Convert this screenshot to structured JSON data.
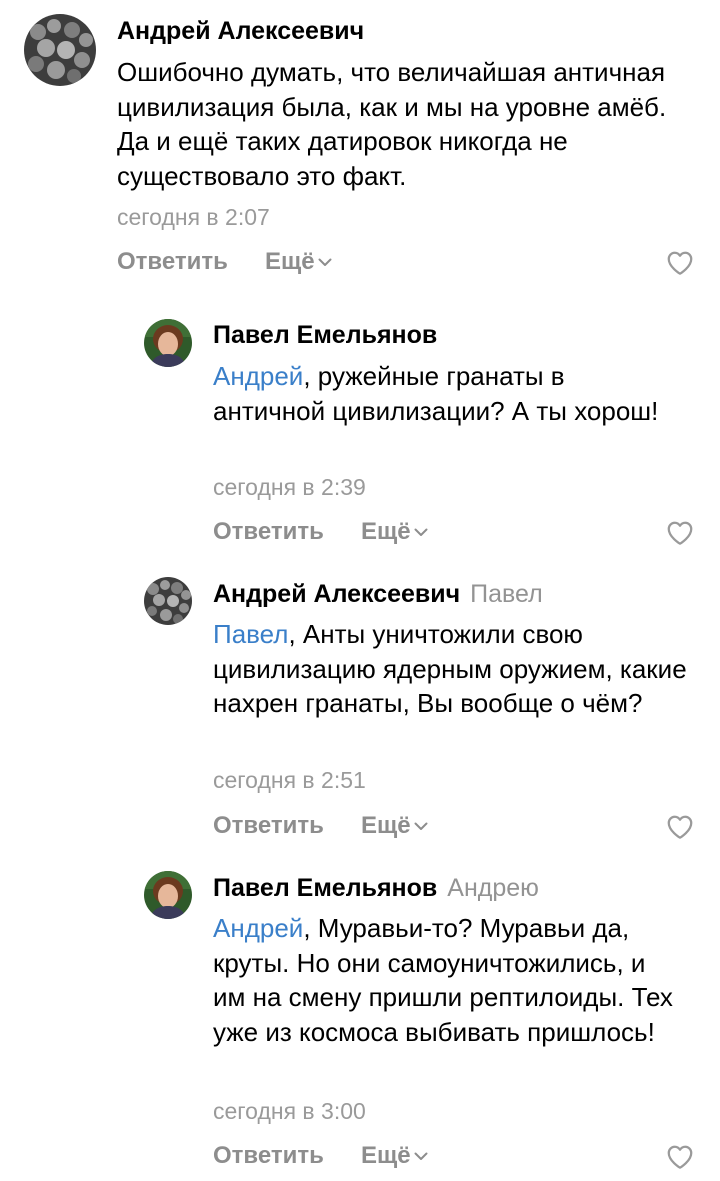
{
  "comments": [
    {
      "author": "Андрей Алексеевич",
      "reply_to": "",
      "mention": "",
      "text": "Ошибочно думать, что величайшая античная цивилизация была, как и мы на уровне амёб. Да и ещё таких датировок никогда не существовало это факт.",
      "time": "сегодня в 2:07",
      "reply_label": "Ответить",
      "more_label": "Ещё",
      "avatar_icon": "group-photo-avatar"
    },
    {
      "author": "Павел Емельянов",
      "reply_to": "",
      "mention": "Андрей",
      "text": ", ружейные гранаты в античной цивилизации? А ты хорош!",
      "time": "сегодня в 2:39",
      "reply_label": "Ответить",
      "more_label": "Ещё",
      "avatar_icon": "person-photo-avatar"
    },
    {
      "author": "Андрей Алексеевич",
      "reply_to": "Павел",
      "mention": "Павел",
      "text": ", Анты уничтожили свою цивилизацию ядерным оружием, какие нахрен гранаты, Вы вообще о чём?",
      "time": "сегодня в 2:51",
      "reply_label": "Ответить",
      "more_label": "Ещё",
      "avatar_icon": "group-photo-avatar"
    },
    {
      "author": "Павел Емельянов",
      "reply_to": "Андрею",
      "mention": "Андрей",
      "text": ", Муравьи-то? Муравьи да, круты. Но они самоуничтожились, и им на смену пришли рептилоиды. Тех уже из космоса выбивать пришлось!",
      "time": "сегодня в 3:00",
      "reply_label": "Ответить",
      "more_label": "Ещё",
      "avatar_icon": "person-photo-avatar"
    }
  ],
  "colors": {
    "mention": "#3a7fc9",
    "secondary": "#939393",
    "action": "#8d8d8d"
  }
}
